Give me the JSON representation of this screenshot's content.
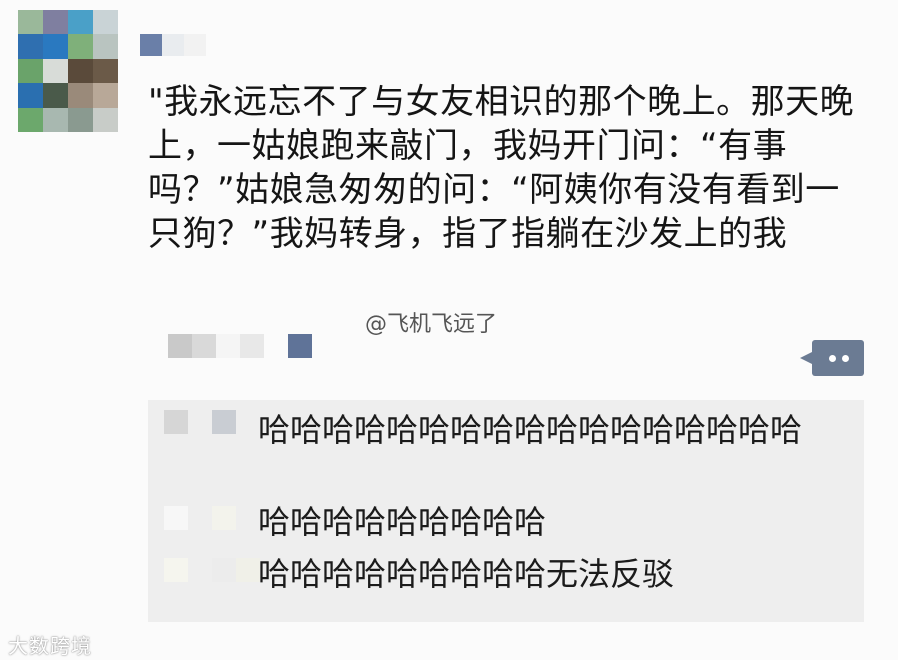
{
  "post": {
    "text": "\"我永远忘不了与女友相识的那个晚上。那天晚上，一姑娘跑来敲门，我妈开门问：“有事吗？”姑娘急匆匆的问：“阿姨你有没有看到一只狗？”我妈转身，指了指躺在沙发上的我",
    "watermark": "@飞机飞远了"
  },
  "comments": [
    {
      "text": "哈哈哈哈哈哈哈哈哈哈哈哈哈哈哈哈哈"
    },
    {
      "text": "哈哈哈哈哈哈哈哈哈"
    },
    {
      "text": "哈哈哈哈哈哈哈哈哈无法反驳"
    }
  ],
  "footer": {
    "logo": "大数跨境"
  },
  "colors": {
    "comment_button": "#6b7b93",
    "comment_box": "#eeeeee",
    "page": "#fbfbfb"
  }
}
